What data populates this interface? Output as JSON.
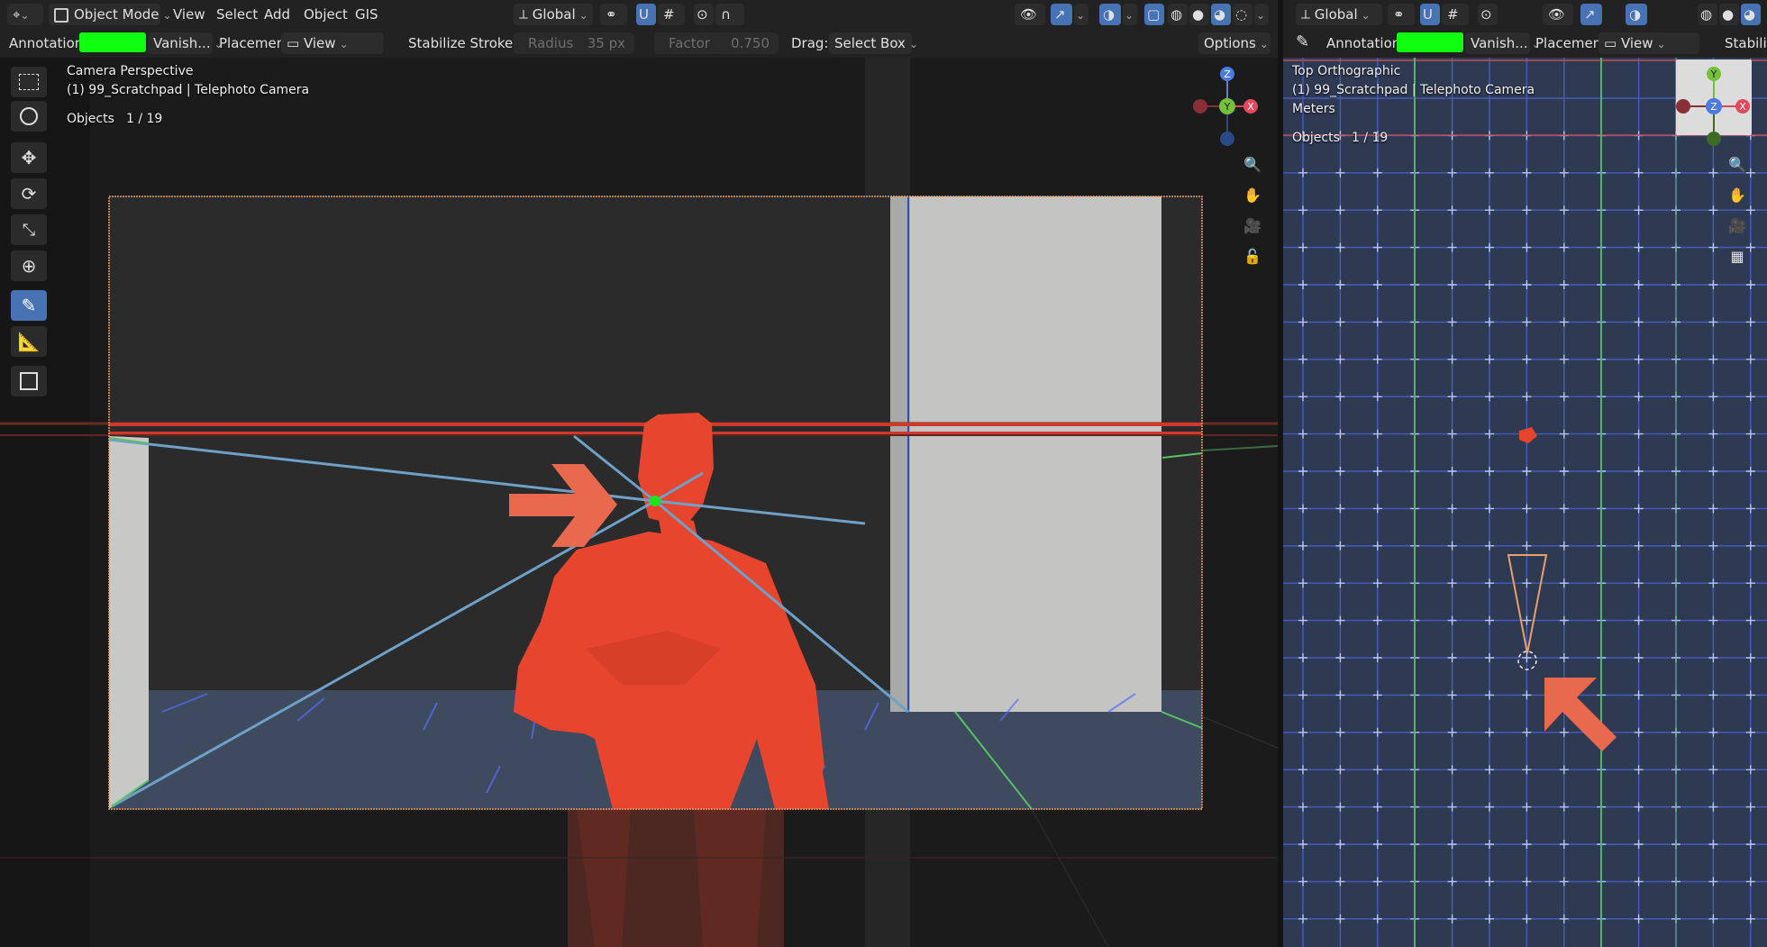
{
  "left": {
    "header": {
      "editor_icon": "view3d-editor-icon",
      "mode": "Object Mode",
      "menus": [
        "View",
        "Select",
        "Add",
        "Object",
        "GIS"
      ],
      "orientation": "Global"
    },
    "toolsettings": {
      "annotation_label": "Annotation:",
      "annotation_color": "#10ff10",
      "annotation_mode": "Vanish...",
      "placement_label": "Placement:",
      "placement_value": "View",
      "stabilize_label": "Stabilize Stroke",
      "radius_label": "Radius",
      "radius_value": "35 px",
      "factor_label": "Factor",
      "factor_value": "0.750",
      "drag_label": "Drag:",
      "drag_value": "Select Box",
      "options_label": "Options"
    },
    "overlay": {
      "view_name": "Camera Perspective",
      "scene_info": "(1) 99_Scratchpad | Telephoto Camera",
      "objects_label": "Objects",
      "objects_count": "1 / 19"
    },
    "gizmo": {
      "z": "Z",
      "y": "Y",
      "x": "X"
    },
    "tools": [
      "select-box-icon",
      "cursor-icon",
      "move-icon",
      "rotate-icon",
      "scale-icon",
      "transform-icon",
      "annotate-icon",
      "measure-icon",
      "add-cube-icon"
    ],
    "nav": [
      "zoom-icon",
      "pan-hand-icon",
      "camera-icon",
      "lock-icon"
    ]
  },
  "right": {
    "header": {
      "orientation": "Global"
    },
    "toolsettings": {
      "annotation_label": "Annotation:",
      "annotation_color": "#10ff10",
      "annotation_mode": "Vanish...",
      "placement_label": "Placement:",
      "placement_value": "View",
      "stabilize_label": "Stabiliz"
    },
    "overlay": {
      "view_name": "Top Orthographic",
      "scene_info": "(1) 99_Scratchpad | Telephoto Camera",
      "units": "Meters",
      "objects_label": "Objects",
      "objects_count": "1 / 19"
    },
    "gizmo": {
      "z": "Z",
      "y": "Y",
      "x": "X"
    },
    "nav": [
      "zoom-icon",
      "pan-hand-icon",
      "camera-icon",
      "grid-icon"
    ]
  },
  "colors": {
    "accent": "#4772b3",
    "figure": "#e8452e",
    "arrow": "#e9694f",
    "guide_line": "#6fa0c8",
    "horizon": "#d0382a"
  }
}
